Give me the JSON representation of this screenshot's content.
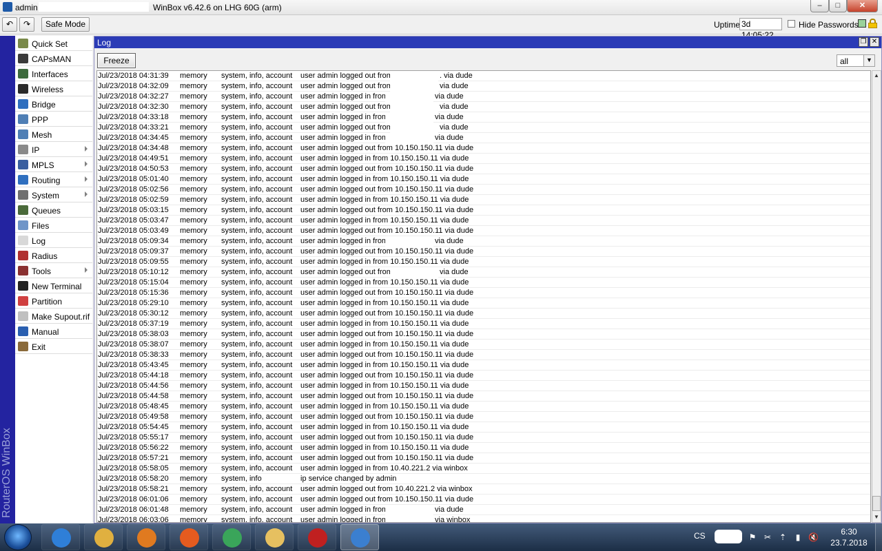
{
  "window": {
    "user": "admin",
    "title": "WinBox v6.42.6 on LHG 60G (arm)",
    "min_glyph": "–",
    "max_glyph": "□",
    "close_glyph": "✕"
  },
  "toolbar": {
    "undo_glyph": "↶",
    "redo_glyph": "↷",
    "safe_mode_label": "Safe Mode",
    "uptime_label": "Uptime:",
    "uptime_value": "3d 14:05:22",
    "hide_passwords_label": "Hide Passwords"
  },
  "brand": "RouterOS WinBox",
  "menu": [
    {
      "label": "Quick Set",
      "icon": "quick-set-icon",
      "color": "#7a8a4a",
      "submenu": false
    },
    {
      "label": "CAPsMAN",
      "icon": "capsman-icon",
      "color": "#3a3a3a",
      "submenu": false
    },
    {
      "label": "Interfaces",
      "icon": "interfaces-icon",
      "color": "#3d6b3d",
      "submenu": false
    },
    {
      "label": "Wireless",
      "icon": "wireless-icon",
      "color": "#2a2a2a",
      "submenu": false
    },
    {
      "label": "Bridge",
      "icon": "bridge-icon",
      "color": "#2f6fbf",
      "submenu": false
    },
    {
      "label": "PPP",
      "icon": "ppp-icon",
      "color": "#4f7fb5",
      "submenu": false
    },
    {
      "label": "Mesh",
      "icon": "mesh-icon",
      "color": "#4f7fb5",
      "submenu": false
    },
    {
      "label": "IP",
      "icon": "ip-icon",
      "color": "#8a8a8a",
      "submenu": true
    },
    {
      "label": "MPLS",
      "icon": "mpls-icon",
      "color": "#3a5fa0",
      "submenu": true
    },
    {
      "label": "Routing",
      "icon": "routing-icon",
      "color": "#2f6fbf",
      "submenu": true
    },
    {
      "label": "System",
      "icon": "system-gear-icon",
      "color": "#707070",
      "submenu": true
    },
    {
      "label": "Queues",
      "icon": "queues-icon",
      "color": "#4a6a3a",
      "submenu": false
    },
    {
      "label": "Files",
      "icon": "files-icon",
      "color": "#6f95c8",
      "submenu": false
    },
    {
      "label": "Log",
      "icon": "log-icon",
      "color": "#d8d8d8",
      "submenu": false
    },
    {
      "label": "Radius",
      "icon": "radius-icon",
      "color": "#b03030",
      "submenu": false
    },
    {
      "label": "Tools",
      "icon": "tools-icon",
      "color": "#8a3030",
      "submenu": true
    },
    {
      "label": "New Terminal",
      "icon": "terminal-icon",
      "color": "#222222",
      "submenu": false
    },
    {
      "label": "Partition",
      "icon": "partition-icon",
      "color": "#d04040",
      "submenu": false
    },
    {
      "label": "Make Supout.rif",
      "icon": "supout-icon",
      "color": "#c0c0c0",
      "submenu": false
    },
    {
      "label": "Manual",
      "icon": "manual-help-icon",
      "color": "#2a5fb0",
      "submenu": false
    },
    {
      "label": "Exit",
      "icon": "exit-door-icon",
      "color": "#8a6a3a",
      "submenu": false
    }
  ],
  "log_window": {
    "title": "Log",
    "freeze_label": "Freeze",
    "topic_filter": "all",
    "restore_glyph": "❐",
    "close_glyph": "✕",
    "dropdown_glyph": "▼",
    "scroll_up_glyph": "▲",
    "scroll_down_glyph": "▼"
  },
  "log_entries": [
    {
      "time": "Jul/23/2018 04:31:39",
      "buffer": "memory",
      "topics": "system, info, account",
      "message": "user admin logged out from",
      "tail": ". via dude",
      "masked": true
    },
    {
      "time": "Jul/23/2018 04:32:09",
      "buffer": "memory",
      "topics": "system, info, account",
      "message": "user admin logged out from",
      "tail": "via dude",
      "masked": true
    },
    {
      "time": "Jul/23/2018 04:32:27",
      "buffer": "memory",
      "topics": "system, info, account",
      "message": "user admin logged in from",
      "tail": "via dude",
      "masked": true
    },
    {
      "time": "Jul/23/2018 04:32:30",
      "buffer": "memory",
      "topics": "system, info, account",
      "message": "user admin logged out from",
      "tail": "via dude",
      "masked": true
    },
    {
      "time": "Jul/23/2018 04:33:18",
      "buffer": "memory",
      "topics": "system, info, account",
      "message": "user admin logged in from",
      "tail": "via dude",
      "masked": true
    },
    {
      "time": "Jul/23/2018 04:33:21",
      "buffer": "memory",
      "topics": "system, info, account",
      "message": "user admin logged out from",
      "tail": "via dude",
      "masked": true
    },
    {
      "time": "Jul/23/2018 04:34:45",
      "buffer": "memory",
      "topics": "system, info, account",
      "message": "user admin logged in from",
      "tail": "via dude",
      "masked": true
    },
    {
      "time": "Jul/23/2018 04:34:48",
      "buffer": "memory",
      "topics": "system, info, account",
      "message": "user admin logged out from 10.150.150.11 via dude",
      "masked": false
    },
    {
      "time": "Jul/23/2018 04:49:51",
      "buffer": "memory",
      "topics": "system, info, account",
      "message": "user admin logged in from 10.150.150.11 via dude",
      "masked": false
    },
    {
      "time": "Jul/23/2018 04:50:53",
      "buffer": "memory",
      "topics": "system, info, account",
      "message": "user admin logged out from 10.150.150.11 via dude",
      "masked": false
    },
    {
      "time": "Jul/23/2018 05:01:40",
      "buffer": "memory",
      "topics": "system, info, account",
      "message": "user admin logged in from 10.150.150.11 via dude",
      "masked": false
    },
    {
      "time": "Jul/23/2018 05:02:56",
      "buffer": "memory",
      "topics": "system, info, account",
      "message": "user admin logged out from 10.150.150.11 via dude",
      "masked": false
    },
    {
      "time": "Jul/23/2018 05:02:59",
      "buffer": "memory",
      "topics": "system, info, account",
      "message": "user admin logged in from 10.150.150.11 via dude",
      "masked": false
    },
    {
      "time": "Jul/23/2018 05:03:15",
      "buffer": "memory",
      "topics": "system, info, account",
      "message": "user admin logged out from 10.150.150.11 via dude",
      "masked": false
    },
    {
      "time": "Jul/23/2018 05:03:47",
      "buffer": "memory",
      "topics": "system, info, account",
      "message": "user admin logged in from 10.150.150.11 via dude",
      "masked": false
    },
    {
      "time": "Jul/23/2018 05:03:49",
      "buffer": "memory",
      "topics": "system, info, account",
      "message": "user admin logged out from 10.150.150.11 via dude",
      "masked": false
    },
    {
      "time": "Jul/23/2018 05:09:34",
      "buffer": "memory",
      "topics": "system, info, account",
      "message": "user admin logged in from",
      "tail": "via dude",
      "masked": true
    },
    {
      "time": "Jul/23/2018 05:09:37",
      "buffer": "memory",
      "topics": "system, info, account",
      "message": "user admin logged out from 10.150.150.11 via dude",
      "masked": false
    },
    {
      "time": "Jul/23/2018 05:09:55",
      "buffer": "memory",
      "topics": "system, info, account",
      "message": "user admin logged in from 10.150.150.11 via dude",
      "masked": false
    },
    {
      "time": "Jul/23/2018 05:10:12",
      "buffer": "memory",
      "topics": "system, info, account",
      "message": "user admin logged out from",
      "tail": "via dude",
      "masked": true
    },
    {
      "time": "Jul/23/2018 05:15:04",
      "buffer": "memory",
      "topics": "system, info, account",
      "message": "user admin logged in from 10.150.150.11 via dude",
      "masked": false
    },
    {
      "time": "Jul/23/2018 05:15:36",
      "buffer": "memory",
      "topics": "system, info, account",
      "message": "user admin logged out from 10.150.150.11 via dude",
      "masked": false
    },
    {
      "time": "Jul/23/2018 05:29:10",
      "buffer": "memory",
      "topics": "system, info, account",
      "message": "user admin logged in from 10.150.150.11 via dude",
      "masked": false
    },
    {
      "time": "Jul/23/2018 05:30:12",
      "buffer": "memory",
      "topics": "system, info, account",
      "message": "user admin logged out from 10.150.150.11 via dude",
      "masked": false
    },
    {
      "time": "Jul/23/2018 05:37:19",
      "buffer": "memory",
      "topics": "system, info, account",
      "message": "user admin logged in from 10.150.150.11 via dude",
      "masked": false
    },
    {
      "time": "Jul/23/2018 05:38:03",
      "buffer": "memory",
      "topics": "system, info, account",
      "message": "user admin logged out from 10.150.150.11 via dude",
      "masked": false
    },
    {
      "time": "Jul/23/2018 05:38:07",
      "buffer": "memory",
      "topics": "system, info, account",
      "message": "user admin logged in from 10.150.150.11 via dude",
      "masked": false
    },
    {
      "time": "Jul/23/2018 05:38:33",
      "buffer": "memory",
      "topics": "system, info, account",
      "message": "user admin logged out from 10.150.150.11 via dude",
      "masked": false
    },
    {
      "time": "Jul/23/2018 05:43:45",
      "buffer": "memory",
      "topics": "system, info, account",
      "message": "user admin logged in from 10.150.150.11 via dude",
      "masked": false
    },
    {
      "time": "Jul/23/2018 05:44:18",
      "buffer": "memory",
      "topics": "system, info, account",
      "message": "user admin logged out from 10.150.150.11 via dude",
      "masked": false
    },
    {
      "time": "Jul/23/2018 05:44:56",
      "buffer": "memory",
      "topics": "system, info, account",
      "message": "user admin logged in from 10.150.150.11 via dude",
      "masked": false
    },
    {
      "time": "Jul/23/2018 05:44:58",
      "buffer": "memory",
      "topics": "system, info, account",
      "message": "user admin logged out from 10.150.150.11 via dude",
      "masked": false
    },
    {
      "time": "Jul/23/2018 05:48:45",
      "buffer": "memory",
      "topics": "system, info, account",
      "message": "user admin logged in from 10.150.150.11 via dude",
      "masked": false
    },
    {
      "time": "Jul/23/2018 05:49:58",
      "buffer": "memory",
      "topics": "system, info, account",
      "message": "user admin logged out from 10.150.150.11 via dude",
      "masked": false
    },
    {
      "time": "Jul/23/2018 05:54:45",
      "buffer": "memory",
      "topics": "system, info, account",
      "message": "user admin logged in from 10.150.150.11 via dude",
      "masked": false
    },
    {
      "time": "Jul/23/2018 05:55:17",
      "buffer": "memory",
      "topics": "system, info, account",
      "message": "user admin logged out from 10.150.150.11 via dude",
      "masked": false
    },
    {
      "time": "Jul/23/2018 05:56:22",
      "buffer": "memory",
      "topics": "system, info, account",
      "message": "user admin logged in from 10.150.150.11 via dude",
      "masked": false
    },
    {
      "time": "Jul/23/2018 05:57:21",
      "buffer": "memory",
      "topics": "system, info, account",
      "message": "user admin logged out from 10.150.150.11 via dude",
      "masked": false
    },
    {
      "time": "Jul/23/2018 05:58:05",
      "buffer": "memory",
      "topics": "system, info, account",
      "message": "user admin logged in from 10.40.221.2 via winbox",
      "masked": false
    },
    {
      "time": "Jul/23/2018 05:58:20",
      "buffer": "memory",
      "topics": "system, info",
      "message": "ip service changed by admin",
      "masked": false
    },
    {
      "time": "Jul/23/2018 05:58:21",
      "buffer": "memory",
      "topics": "system, info, account",
      "message": "user admin logged out from 10.40.221.2 via winbox",
      "masked": false
    },
    {
      "time": "Jul/23/2018 06:01:06",
      "buffer": "memory",
      "topics": "system, info, account",
      "message": "user admin logged out from 10.150.150.11 via dude",
      "masked": false
    },
    {
      "time": "Jul/23/2018 06:01:48",
      "buffer": "memory",
      "topics": "system, info, account",
      "message": "user admin logged in from",
      "tail": "via dude",
      "masked": true
    },
    {
      "time": "Jul/23/2018 06:03:06",
      "buffer": "memory",
      "topics": "system, info, account",
      "message": "user admin logged in from",
      "tail": "via winbox",
      "masked": true
    }
  ],
  "taskbar": {
    "apps": [
      {
        "name": "ie-icon",
        "color": "#2f7fd8",
        "active": false
      },
      {
        "name": "explorer-icon",
        "color": "#e0b040",
        "active": false
      },
      {
        "name": "media-player-icon",
        "color": "#e07a20",
        "active": false
      },
      {
        "name": "firefox-icon",
        "color": "#e55b1f",
        "active": false
      },
      {
        "name": "chrome-icon",
        "color": "#3aa55a",
        "active": false
      },
      {
        "name": "mail-icon",
        "color": "#e6c060",
        "active": false
      },
      {
        "name": "dude-icon",
        "color": "#c02020",
        "active": false
      },
      {
        "name": "winbox-icon",
        "color": "#3b7fd0",
        "active": true
      }
    ],
    "language": "CS",
    "tray_glyphs": [
      "⚑",
      "✂",
      "⇡",
      "▮",
      "🔇"
    ],
    "clock_time": "6:30",
    "clock_date": "23.7.2018"
  }
}
